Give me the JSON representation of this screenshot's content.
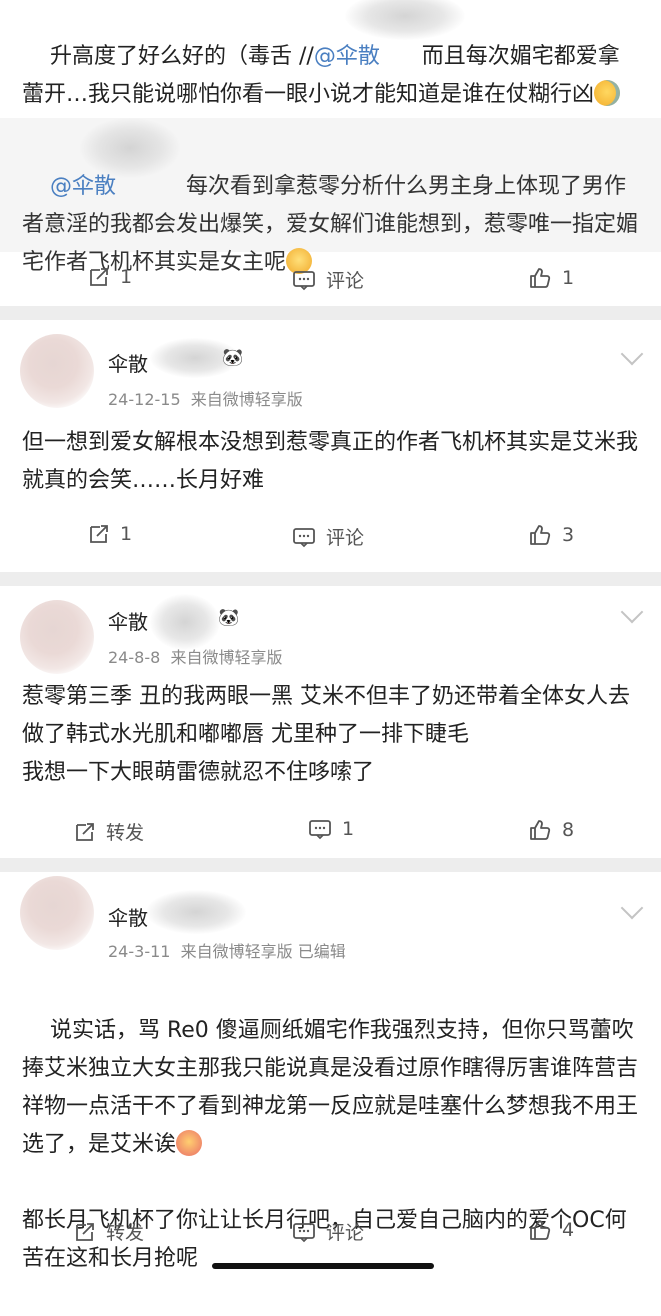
{
  "top_post": {
    "text_part1": "升高度了好么好的（毒舌 //",
    "mention": "@伞散",
    "text_part2": "而且每次媚宅都爱拿蕾开…我只能说哪怕你看一眼小说才能知道是谁在仗糊行凶",
    "emoji": "cry-laugh-icon"
  },
  "quoted_post": {
    "mention": "@伞散",
    "text": "每次看到拿惹零分析什么男主身上体现了男作者意淫的我都会发出爆笑，爱女解们谁能想到，惹零唯一指定媚宅作者飞机杯其实是女主呢",
    "emoji": "smile-icon"
  },
  "top_actions": {
    "repost": "1",
    "comment": "评论",
    "like": "1"
  },
  "comments": [
    {
      "username": "伞散",
      "date": "24-12-15",
      "source": "来自微博轻享版",
      "edited": "",
      "text": "但一想到爱女解根本没想到惹零真正的作者飞机杯其实是艾米我就真的会笑……长月好难",
      "actions": {
        "repost": "1",
        "comment": "评论",
        "like": "3"
      }
    },
    {
      "username": "伞散",
      "date": "24-8-8",
      "source": "来自微博轻享版",
      "edited": "",
      "text": "惹零第三季 丑的我两眼一黑 艾米不但丰了奶还带着全体女人去做了韩式水光肌和嘟嘟唇 尤里种了一排下睫毛\n我想一下大眼萌雷德就忍不住哆嗦了",
      "actions": {
        "repost": "转发",
        "comment": "1",
        "like": "8"
      }
    },
    {
      "username": "伞散",
      "date": "24-3-11",
      "source": "来自微博轻享版",
      "edited": "已编辑",
      "text_main": "说实话，骂 Re0 傻逼厕纸媚宅作我强烈支持，但你只骂蕾吹捧艾米独立大女主那我只能说真是没看过原作瞎得厉害谁阵营吉祥物一点活干不了看到神龙第一反应就是哇塞什么梦想我不用王选了，是艾米诶",
      "text_tail": "都长月飞机杯了你让让长月行吧，自己爱自己脑内的爱个OC何苦在这和长月抢呢",
      "actions": {
        "repost": "转发",
        "comment": "评论",
        "like": "4"
      }
    }
  ],
  "icons": {
    "repost": "repost-icon",
    "comment": "comment-icon",
    "like": "like-icon",
    "more": "chevron-down-icon",
    "panda": "panda-icon"
  },
  "colors": {
    "mention": "#4a7fc1",
    "meta": "#8a8a8a",
    "divider": "#ededed",
    "quote_bg": "#f5f5f5"
  }
}
